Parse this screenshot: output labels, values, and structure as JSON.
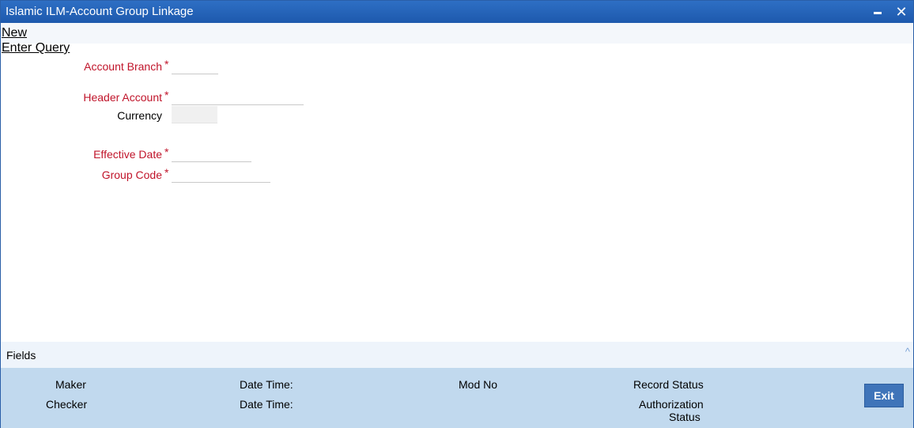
{
  "window": {
    "title": "Islamic ILM-Account Group Linkage"
  },
  "toolbar": {
    "new_label": "New",
    "enter_query_label": "Enter Query"
  },
  "form": {
    "account_branch": {
      "label": "Account Branch",
      "required_mark": "*",
      "value": ""
    },
    "header_account": {
      "label": "Header Account",
      "required_mark": "*",
      "value": ""
    },
    "currency": {
      "label": "Currency",
      "value": ""
    },
    "effective_date": {
      "label": "Effective Date",
      "required_mark": "*",
      "value": ""
    },
    "group_code": {
      "label": "Group Code",
      "required_mark": "*",
      "value": ""
    }
  },
  "fields_section": {
    "label": "Fields"
  },
  "audit": {
    "maker": "Maker",
    "maker_date_time": "Date Time:",
    "mod_no": "Mod No",
    "record_status": "Record Status",
    "checker": "Checker",
    "checker_date_time": "Date Time:",
    "authorization_status_line1": "Authorization",
    "authorization_status_line2": "Status",
    "exit_label": "Exit"
  },
  "colors": {
    "titlebar": "#1d59ad",
    "required": "#c0142a",
    "audit_bg": "#c1d9ee",
    "exit_bg": "#3f74b9"
  }
}
